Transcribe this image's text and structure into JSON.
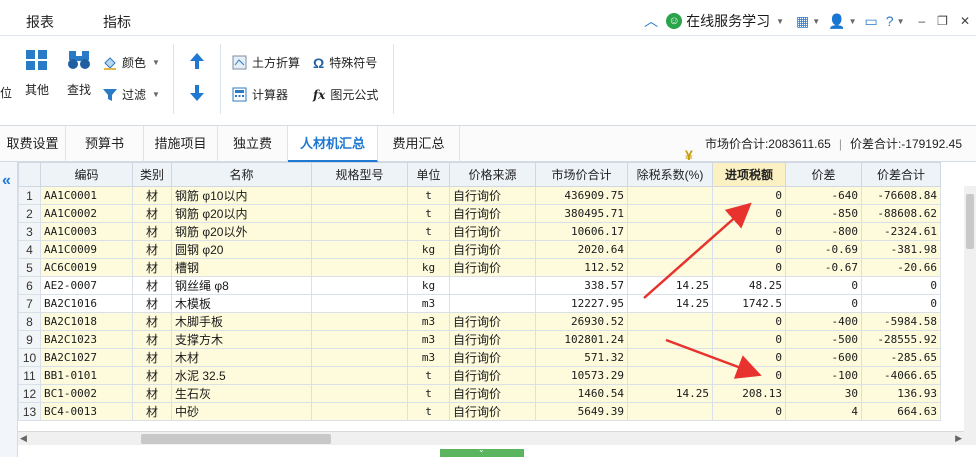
{
  "menubar": {
    "report_label": "报表",
    "index_label": "指标",
    "online_label": "在线服务学习",
    "collapse_icon": "chevron-up-icon",
    "help_label": "?"
  },
  "ribbon": {
    "truncated_label": "位",
    "other_label": "其他",
    "find_label": "查找",
    "color_label": "颜色",
    "filter_label": "过滤",
    "earthwork_label": "土方折算",
    "special_symbol_label": "特殊符号",
    "calculator_label": "计算器",
    "formula_label": "图元公式"
  },
  "tabs": [
    {
      "label": "取费设置"
    },
    {
      "label": "预算书"
    },
    {
      "label": "措施项目"
    },
    {
      "label": "独立费"
    },
    {
      "label": "人材机汇总"
    },
    {
      "label": "费用汇总"
    }
  ],
  "summary": {
    "market_total": "市场价合计:2083611.65",
    "diff_total": "价差合计:-179192.45"
  },
  "table": {
    "headers": [
      "编码",
      "类别",
      "名称",
      "规格型号",
      "单位",
      "价格来源",
      "市场价合计",
      "除税系数(%)",
      "进项税额",
      "价差",
      "价差合计"
    ],
    "rows": [
      {
        "idx": "1",
        "code": "AA1C0001",
        "type": "材",
        "name": "钢筋 φ10以内",
        "spec": "",
        "unit": "t",
        "source": "自行询价",
        "market": "436909.75",
        "coef": "",
        "tax": "0",
        "diff": "-640",
        "diff_total": "-76608.84"
      },
      {
        "idx": "2",
        "code": "AA1C0002",
        "type": "材",
        "name": "钢筋 φ20以内",
        "spec": "",
        "unit": "t",
        "source": "自行询价",
        "market": "380495.71",
        "coef": "",
        "tax": "0",
        "diff": "-850",
        "diff_total": "-88608.62"
      },
      {
        "idx": "3",
        "code": "AA1C0003",
        "type": "材",
        "name": "钢筋 φ20以外",
        "spec": "",
        "unit": "t",
        "source": "自行询价",
        "market": "10606.17",
        "coef": "",
        "tax": "0",
        "diff": "-800",
        "diff_total": "-2324.61"
      },
      {
        "idx": "4",
        "code": "AA1C0009",
        "type": "材",
        "name": "圆钢 φ20",
        "spec": "",
        "unit": "kg",
        "source": "自行询价",
        "market": "2020.64",
        "coef": "",
        "tax": "0",
        "diff": "-0.69",
        "diff_total": "-381.98"
      },
      {
        "idx": "5",
        "code": "AC6C0019",
        "type": "材",
        "name": "槽钢",
        "spec": "",
        "unit": "kg",
        "source": "自行询价",
        "market": "112.52",
        "coef": "",
        "tax": "0",
        "diff": "-0.67",
        "diff_total": "-20.66"
      },
      {
        "idx": "6",
        "code": "AE2-0007",
        "type": "材",
        "name": "钢丝绳 φ8",
        "spec": "",
        "unit": "kg",
        "source": "",
        "market": "338.57",
        "coef": "14.25",
        "tax": "48.25",
        "diff": "0",
        "diff_total": "0"
      },
      {
        "idx": "7",
        "code": "BA2C1016",
        "type": "材",
        "name": "木模板",
        "spec": "",
        "unit": "m3",
        "source": "",
        "market": "12227.95",
        "coef": "14.25",
        "tax": "1742.5",
        "diff": "0",
        "diff_total": "0"
      },
      {
        "idx": "8",
        "code": "BA2C1018",
        "type": "材",
        "name": "木脚手板",
        "spec": "",
        "unit": "m3",
        "source": "自行询价",
        "market": "26930.52",
        "coef": "",
        "tax": "0",
        "diff": "-400",
        "diff_total": "-5984.58"
      },
      {
        "idx": "9",
        "code": "BA2C1023",
        "type": "材",
        "name": "支撑方木",
        "spec": "",
        "unit": "m3",
        "source": "自行询价",
        "market": "102801.24",
        "coef": "",
        "tax": "0",
        "diff": "-500",
        "diff_total": "-28555.92"
      },
      {
        "idx": "10",
        "code": "BA2C1027",
        "type": "材",
        "name": "木材",
        "spec": "",
        "unit": "m3",
        "source": "自行询价",
        "market": "571.32",
        "coef": "",
        "tax": "0",
        "diff": "-600",
        "diff_total": "-285.65"
      },
      {
        "idx": "11",
        "code": "BB1-0101",
        "type": "材",
        "name": "水泥 32.5",
        "spec": "",
        "unit": "t",
        "source": "自行询价",
        "market": "10573.29",
        "coef": "",
        "tax": "0",
        "diff": "-100",
        "diff_total": "-4066.65"
      },
      {
        "idx": "12",
        "code": "BC1-0002",
        "type": "材",
        "name": "生石灰",
        "spec": "",
        "unit": "t",
        "source": "自行询价",
        "market": "1460.54",
        "coef": "14.25",
        "tax": "208.13",
        "diff": "30",
        "diff_total": "136.93"
      },
      {
        "idx": "13",
        "code": "BC4-0013",
        "type": "材",
        "name": "中砂",
        "spec": "",
        "unit": "t",
        "source": "自行询价",
        "market": "5649.39",
        "coef": "",
        "tax": "0",
        "diff": "4",
        "diff_total": "664.63"
      }
    ]
  },
  "colors": {
    "accent": "#1f78d1",
    "row_yellow": "#fdfbdc",
    "highlight_header": "#fcf1c2",
    "annotation_arrow": "#e8322d"
  }
}
